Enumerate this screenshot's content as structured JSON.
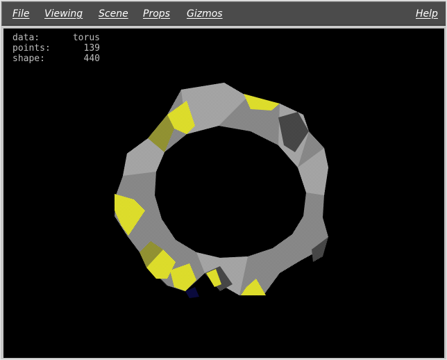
{
  "menubar": {
    "items": [
      {
        "label": "File"
      },
      {
        "label": "Viewing"
      },
      {
        "label": "Scene"
      },
      {
        "label": "Props"
      },
      {
        "label": "Gizmos"
      }
    ],
    "help_label": "Help"
  },
  "info": {
    "rows": [
      {
        "label": "data:",
        "value": "torus"
      },
      {
        "label": "points:",
        "value": "139"
      },
      {
        "label": "shape:",
        "value": "440"
      }
    ]
  },
  "colors": {
    "menubar_bg": "#4b4b4b",
    "window_frame": "#c8c8c8",
    "viewport_bg": "#000000",
    "surface_gray": "#9a9a9a",
    "surface_yellow": "#e6e61e",
    "surface_dark": "#3a3a3a"
  }
}
